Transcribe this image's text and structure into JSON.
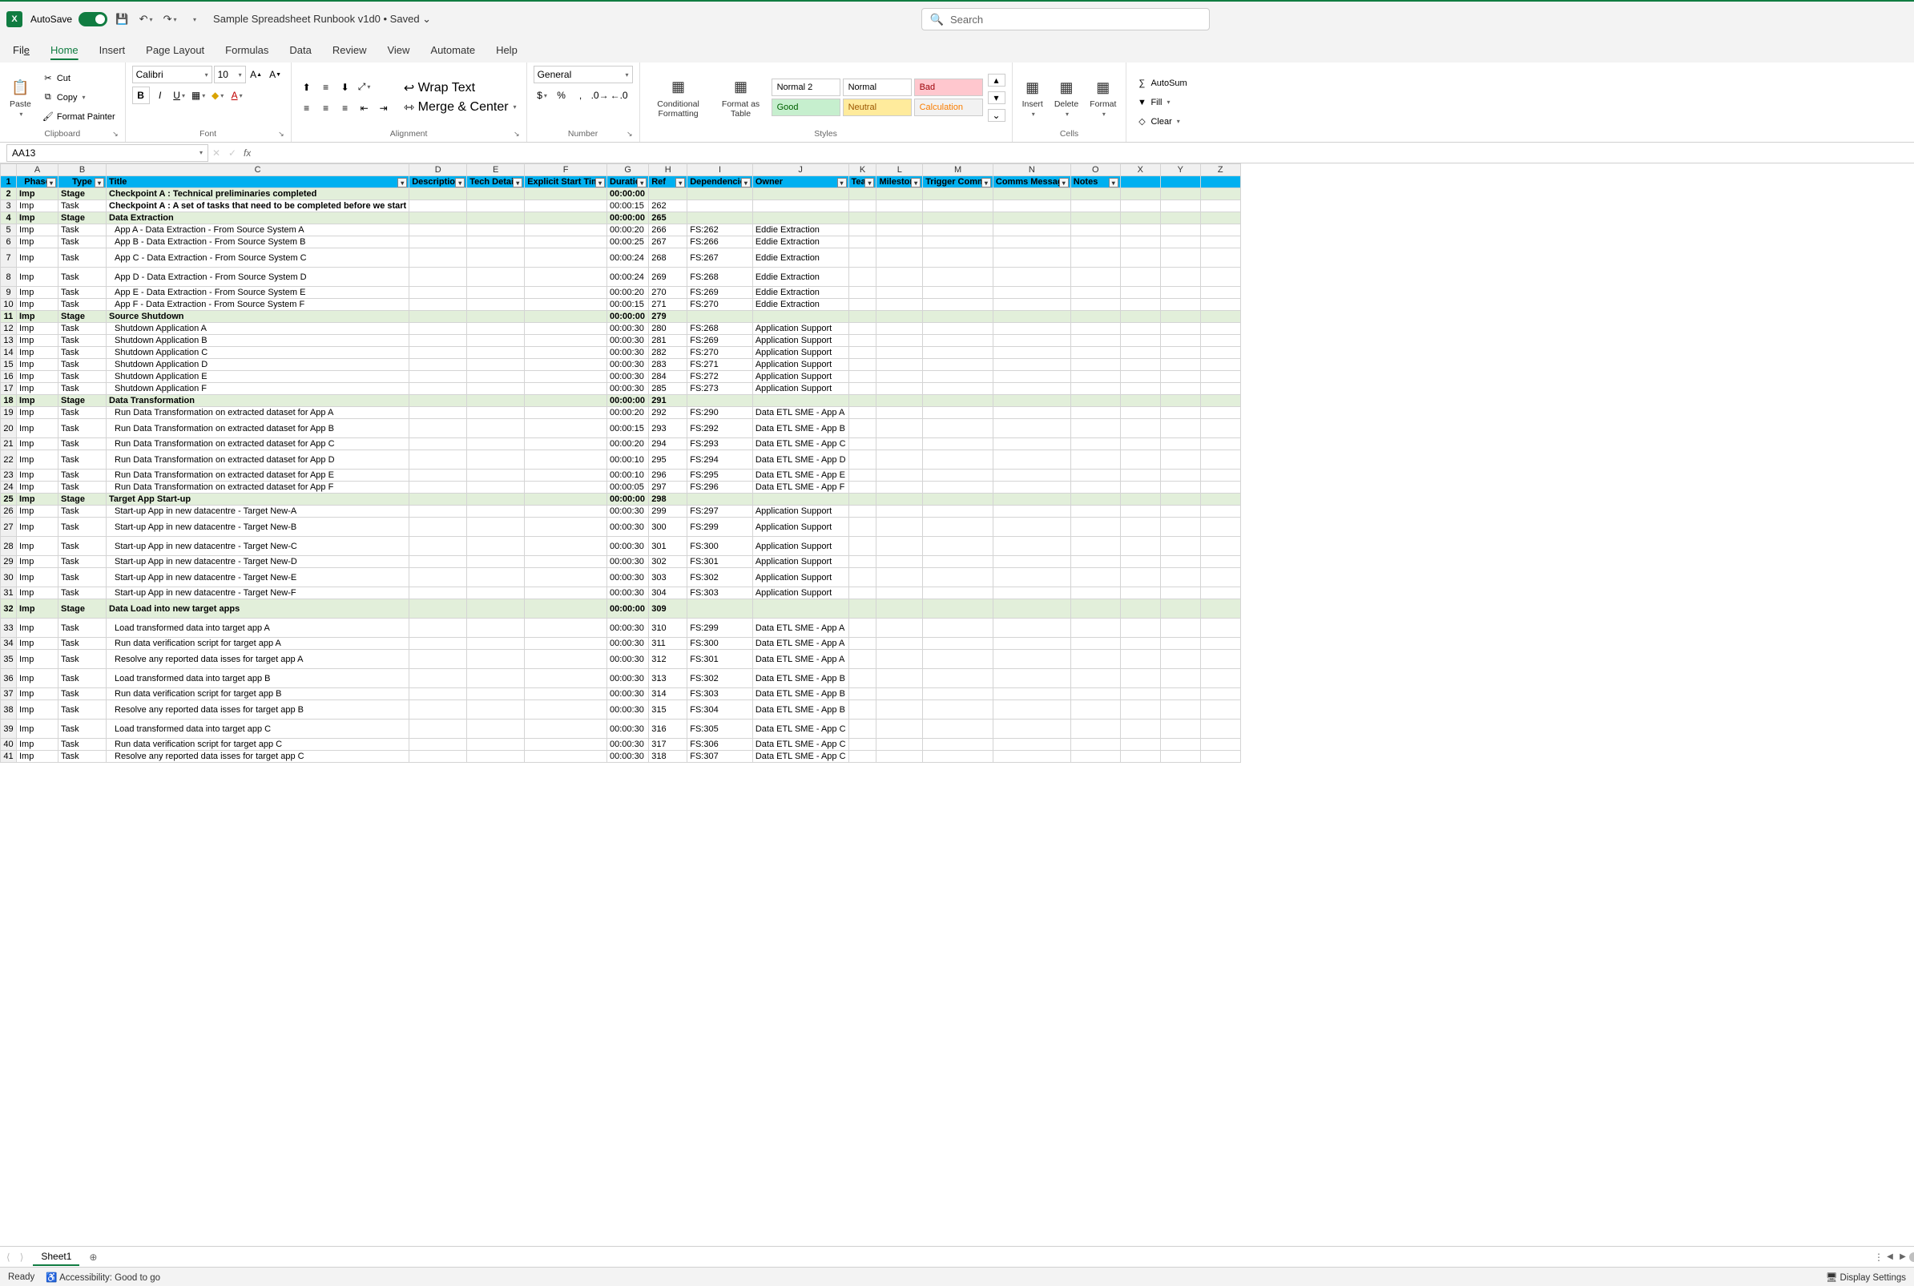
{
  "title": {
    "autosave": "AutoSave",
    "doc": "Sample Spreadsheet Runbook v1d0 • Saved ⌄",
    "search": "Search"
  },
  "tabs": {
    "file": "File",
    "home": "Home",
    "insert": "Insert",
    "page": "Page Layout",
    "formulas": "Formulas",
    "data": "Data",
    "review": "Review",
    "view": "View",
    "automate": "Automate",
    "help": "Help"
  },
  "ribbon": {
    "clipboard": {
      "paste": "Paste",
      "cut": "Cut",
      "copy": "Copy",
      "fp": "Format Painter",
      "label": "Clipboard"
    },
    "font": {
      "name": "Calibri",
      "size": "10",
      "label": "Font"
    },
    "alignment": {
      "wrap": "Wrap Text",
      "merge": "Merge & Center",
      "label": "Alignment"
    },
    "number": {
      "general": "General",
      "label": "Number"
    },
    "styles": {
      "conditional": "Conditional Formatting",
      "table": "Format as Table",
      "normal2": "Normal 2",
      "normal": "Normal",
      "bad": "Bad",
      "good": "Good",
      "neutral": "Neutral",
      "calc": "Calculation",
      "label": "Styles"
    },
    "cells": {
      "insert": "Insert",
      "delete": "Delete",
      "format": "Format",
      "label": "Cells"
    },
    "editing": {
      "sum": "AutoSum",
      "fill": "Fill",
      "clear": "Clear"
    }
  },
  "formula": {
    "cell": "AA13"
  },
  "cols": [
    "A",
    "B",
    "C",
    "D",
    "E",
    "F",
    "G",
    "H",
    "I",
    "J",
    "K",
    "L",
    "M",
    "N",
    "O",
    "X",
    "Y",
    "Z"
  ],
  "headers": {
    "phase": "Phase",
    "type": "Type",
    "title": "Title",
    "desc": "Description",
    "tech": "Tech Detail",
    "explicit": "Explicit Start Time",
    "duration": "Duration",
    "ref": "Ref",
    "dep": "Dependencies",
    "owner": "Owner",
    "team": "Team",
    "milestone": "Milestone",
    "trigger": "Trigger Comms",
    "comms": "Comms Message",
    "notes": "Notes"
  },
  "rows": [
    {
      "n": 2,
      "stage": true,
      "phase": "Imp",
      "type": "Stage",
      "title": "Checkpoint A : Technical preliminaries completed",
      "dur": "00:00:00"
    },
    {
      "n": 3,
      "phase": "Imp",
      "type": "Task",
      "title": "Checkpoint A : A set of tasks that need to be completed before we start",
      "b": true,
      "dur": "00:00:15",
      "ref": "262"
    },
    {
      "n": 4,
      "stage": true,
      "phase": "Imp",
      "type": "Stage",
      "title": "Data Extraction",
      "dur": "00:00:00",
      "ref": "265"
    },
    {
      "n": 5,
      "phase": "Imp",
      "type": "Task",
      "title": "App A - Data Extraction - From Source System A",
      "indent": true,
      "dur": "00:00:20",
      "ref": "266",
      "dep": "FS:262",
      "owner": "Eddie Extraction"
    },
    {
      "n": 6,
      "phase": "Imp",
      "type": "Task",
      "title": "App B - Data Extraction - From Source System B",
      "indent": true,
      "dur": "00:00:25",
      "ref": "267",
      "dep": "FS:266",
      "owner": "Eddie Extraction"
    },
    {
      "n": 7,
      "tall": true,
      "phase": "Imp",
      "type": "Task",
      "title": "App C - Data Extraction - From Source System C",
      "indent": true,
      "dur": "00:00:24",
      "ref": "268",
      "dep": "FS:267",
      "owner": "Eddie Extraction"
    },
    {
      "n": 8,
      "tall": true,
      "phase": "Imp",
      "type": "Task",
      "title": "App D - Data Extraction - From Source System D",
      "indent": true,
      "dur": "00:00:24",
      "ref": "269",
      "dep": "FS:268",
      "owner": "Eddie Extraction"
    },
    {
      "n": 9,
      "phase": "Imp",
      "type": "Task",
      "title": "App E - Data Extraction - From Source System E",
      "indent": true,
      "dur": "00:00:20",
      "ref": "270",
      "dep": "FS:269",
      "owner": "Eddie Extraction"
    },
    {
      "n": 10,
      "phase": "Imp",
      "type": "Task",
      "title": "App F - Data Extraction - From Source System F",
      "indent": true,
      "dur": "00:00:15",
      "ref": "271",
      "dep": "FS:270",
      "owner": "Eddie Extraction"
    },
    {
      "n": 11,
      "stage": true,
      "phase": "Imp",
      "type": "Stage",
      "title": "Source Shutdown",
      "dur": "00:00:00",
      "ref": "279"
    },
    {
      "n": 12,
      "phase": "Imp",
      "type": "Task",
      "title": "Shutdown Application A",
      "indent": true,
      "dur": "00:00:30",
      "ref": "280",
      "dep": "FS:268",
      "owner": "Application Support"
    },
    {
      "n": 13,
      "phase": "Imp",
      "type": "Task",
      "title": "Shutdown Application B",
      "indent": true,
      "dur": "00:00:30",
      "ref": "281",
      "dep": "FS:269",
      "owner": "Application Support",
      "sel": true
    },
    {
      "n": 14,
      "phase": "Imp",
      "type": "Task",
      "title": "Shutdown Application C",
      "indent": true,
      "dur": "00:00:30",
      "ref": "282",
      "dep": "FS:270",
      "owner": "Application Support"
    },
    {
      "n": 15,
      "phase": "Imp",
      "type": "Task",
      "title": "Shutdown Application D",
      "indent": true,
      "dur": "00:00:30",
      "ref": "283",
      "dep": "FS:271",
      "owner": "Application Support"
    },
    {
      "n": 16,
      "phase": "Imp",
      "type": "Task",
      "title": "Shutdown Application E",
      "indent": true,
      "dur": "00:00:30",
      "ref": "284",
      "dep": "FS:272",
      "owner": "Application Support"
    },
    {
      "n": 17,
      "phase": "Imp",
      "type": "Task",
      "title": "Shutdown Application F",
      "indent": true,
      "dur": "00:00:30",
      "ref": "285",
      "dep": "FS:273",
      "owner": "Application Support"
    },
    {
      "n": 18,
      "stage": true,
      "phase": "Imp",
      "type": "Stage",
      "title": "Data Transformation",
      "dur": "00:00:00",
      "ref": "291"
    },
    {
      "n": 19,
      "phase": "Imp",
      "type": "Task",
      "title": "Run Data Transformation on extracted dataset for App A",
      "indent": true,
      "dur": "00:00:20",
      "ref": "292",
      "dep": "FS:290",
      "owner": "Data ETL SME - App A"
    },
    {
      "n": 20,
      "tall": true,
      "phase": "Imp",
      "type": "Task",
      "title": "Run Data Transformation on extracted dataset for App B",
      "indent": true,
      "dur": "00:00:15",
      "ref": "293",
      "dep": "FS:292",
      "owner": "Data ETL SME - App B"
    },
    {
      "n": 21,
      "phase": "Imp",
      "type": "Task",
      "title": "Run Data Transformation on extracted dataset for App C",
      "indent": true,
      "dur": "00:00:20",
      "ref": "294",
      "dep": "FS:293",
      "owner": "Data ETL SME - App C"
    },
    {
      "n": 22,
      "tall": true,
      "phase": "Imp",
      "type": "Task",
      "title": "Run Data Transformation on extracted dataset for App D",
      "indent": true,
      "dur": "00:00:10",
      "ref": "295",
      "dep": "FS:294",
      "owner": "Data ETL SME - App D"
    },
    {
      "n": 23,
      "phase": "Imp",
      "type": "Task",
      "title": "Run Data Transformation on extracted dataset for App E",
      "indent": true,
      "dur": "00:00:10",
      "ref": "296",
      "dep": "FS:295",
      "owner": "Data ETL SME - App E"
    },
    {
      "n": 24,
      "phase": "Imp",
      "type": "Task",
      "title": "Run Data Transformation on extracted dataset for App F",
      "indent": true,
      "dur": "00:00:05",
      "ref": "297",
      "dep": "FS:296",
      "owner": "Data ETL SME - App F"
    },
    {
      "n": 25,
      "stage": true,
      "phase": "Imp",
      "type": "Stage",
      "title": "Target App Start-up",
      "dur": "00:00:00",
      "ref": "298"
    },
    {
      "n": 26,
      "phase": "Imp",
      "type": "Task",
      "title": "Start-up  App in new datacentre - Target New-A",
      "indent": true,
      "dur": "00:00:30",
      "ref": "299",
      "dep": "FS:297",
      "owner": "Application Support"
    },
    {
      "n": 27,
      "tall": true,
      "phase": "Imp",
      "type": "Task",
      "title": "Start-up  App in new datacentre - Target New-B",
      "indent": true,
      "dur": "00:00:30",
      "ref": "300",
      "dep": "FS:299",
      "owner": "Application Support"
    },
    {
      "n": 28,
      "tall": true,
      "phase": "Imp",
      "type": "Task",
      "title": "Start-up  App in new datacentre - Target New-C",
      "indent": true,
      "dur": "00:00:30",
      "ref": "301",
      "dep": "FS:300",
      "owner": "Application Support"
    },
    {
      "n": 29,
      "phase": "Imp",
      "type": "Task",
      "title": "Start-up  App in new datacentre - Target New-D",
      "indent": true,
      "dur": "00:00:30",
      "ref": "302",
      "dep": "FS:301",
      "owner": "Application Support"
    },
    {
      "n": 30,
      "tall": true,
      "phase": "Imp",
      "type": "Task",
      "title": "Start-up  App in new datacentre - Target New-E",
      "indent": true,
      "dur": "00:00:30",
      "ref": "303",
      "dep": "FS:302",
      "owner": "Application Support"
    },
    {
      "n": 31,
      "phase": "Imp",
      "type": "Task",
      "title": "Start-up  App in new datacentre - Target New-F",
      "indent": true,
      "dur": "00:00:30",
      "ref": "304",
      "dep": "FS:303",
      "owner": "Application Support"
    },
    {
      "n": 32,
      "stage": true,
      "tall": true,
      "phase": "Imp",
      "type": "Stage",
      "title": "Data Load into new target apps",
      "dur": "00:00:00",
      "ref": "309"
    },
    {
      "n": 33,
      "tall": true,
      "phase": "Imp",
      "type": "Task",
      "title": "Load transformed data into target app A",
      "indent": true,
      "dur": "00:00:30",
      "ref": "310",
      "dep": "FS:299",
      "owner": "Data ETL SME - App A"
    },
    {
      "n": 34,
      "phase": "Imp",
      "type": "Task",
      "title": "Run data verification script for target app A",
      "indent": true,
      "dur": "00:00:30",
      "ref": "311",
      "dep": "FS:300",
      "owner": "Data ETL SME - App A"
    },
    {
      "n": 35,
      "tall": true,
      "phase": "Imp",
      "type": "Task",
      "title": "Resolve any reported data isses for target app A",
      "indent": true,
      "dur": "00:00:30",
      "ref": "312",
      "dep": "FS:301",
      "owner": "Data ETL SME - App A"
    },
    {
      "n": 36,
      "tall": true,
      "phase": "Imp",
      "type": "Task",
      "title": "Load transformed data into target app B",
      "indent": true,
      "dur": "00:00:30",
      "ref": "313",
      "dep": "FS:302",
      "owner": "Data ETL SME - App B"
    },
    {
      "n": 37,
      "phase": "Imp",
      "type": "Task",
      "title": "Run data verification script for target app B",
      "indent": true,
      "dur": "00:00:30",
      "ref": "314",
      "dep": "FS:303",
      "owner": "Data ETL SME - App B"
    },
    {
      "n": 38,
      "tall": true,
      "phase": "Imp",
      "type": "Task",
      "title": "Resolve any reported data isses for target app B",
      "indent": true,
      "dur": "00:00:30",
      "ref": "315",
      "dep": "FS:304",
      "owner": "Data ETL SME - App B"
    },
    {
      "n": 39,
      "tall": true,
      "phase": "Imp",
      "type": "Task",
      "title": "Load transformed data into target app C",
      "indent": true,
      "dur": "00:00:30",
      "ref": "316",
      "dep": "FS:305",
      "owner": "Data ETL SME - App C"
    },
    {
      "n": 40,
      "phase": "Imp",
      "type": "Task",
      "title": "Run data verification script for target app C",
      "indent": true,
      "dur": "00:00:30",
      "ref": "317",
      "dep": "FS:306",
      "owner": "Data ETL SME - App C"
    },
    {
      "n": 41,
      "phase": "Imp",
      "type": "Task",
      "title": "Resolve any reported data isses for target app C",
      "indent": true,
      "dur": "00:00:30",
      "ref": "318",
      "dep": "FS:307",
      "owner": "Data ETL SME - App C"
    }
  ],
  "sheet": {
    "name": "Sheet1"
  },
  "status": {
    "ready": "Ready",
    "acc": "Accessibility: Good to go",
    "display": "Display Settings"
  }
}
